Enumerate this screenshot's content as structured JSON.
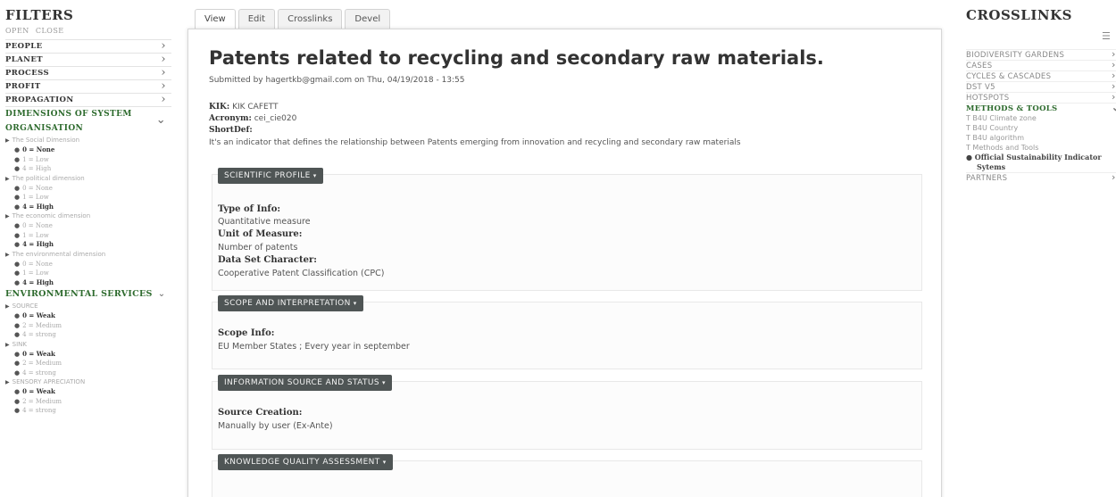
{
  "filters": {
    "title": "FILTERS",
    "open": "OPEN",
    "close": "CLOSE",
    "categories": [
      {
        "label": "PEOPLE"
      },
      {
        "label": "PLANET"
      },
      {
        "label": "PROCESS"
      },
      {
        "label": "PROFIT"
      },
      {
        "label": "PROPAGATION"
      }
    ],
    "dimensions_title_1": "DIMENSIONS OF SYSTEM",
    "dimensions_title_2": "ORGANISATION",
    "dimensions": [
      {
        "label": "The Social Dimension",
        "options": [
          {
            "text": "0 = None",
            "selected": true
          },
          {
            "text": "1 = Low",
            "selected": false
          },
          {
            "text": "4 = High",
            "selected": false
          }
        ]
      },
      {
        "label": "The political dimension",
        "options": [
          {
            "text": "0 = None",
            "selected": false
          },
          {
            "text": "1 = Low",
            "selected": false
          },
          {
            "text": "4 = High",
            "selected": true
          }
        ]
      },
      {
        "label": "The economic dimension",
        "options": [
          {
            "text": "0 = None",
            "selected": false
          },
          {
            "text": "1 = Low",
            "selected": false
          },
          {
            "text": "4 = High",
            "selected": true
          }
        ]
      },
      {
        "label": "The environmental dimension",
        "options": [
          {
            "text": "0 = None",
            "selected": false
          },
          {
            "text": "1 = Low",
            "selected": false
          },
          {
            "text": "4 = High",
            "selected": true
          }
        ]
      }
    ],
    "env_title": "ENVIRONMENTAL SERVICES",
    "env": [
      {
        "label": "SOURCE",
        "options": [
          {
            "text": "0 = Weak",
            "selected": true
          },
          {
            "text": "2 = Medium",
            "selected": false
          },
          {
            "text": "4 = strong",
            "selected": false
          }
        ]
      },
      {
        "label": "SINK",
        "options": [
          {
            "text": "0 = Weak",
            "selected": true
          },
          {
            "text": "2 = Medium",
            "selected": false
          },
          {
            "text": "4 = strong",
            "selected": false
          }
        ]
      },
      {
        "label": "SENSORY APRECIATION",
        "options": [
          {
            "text": "0 = Weak",
            "selected": true
          },
          {
            "text": "2 = Medium",
            "selected": false
          },
          {
            "text": "4 = strong",
            "selected": false
          }
        ]
      }
    ]
  },
  "tabs": [
    "View",
    "Edit",
    "Crosslinks",
    "Devel"
  ],
  "article": {
    "title": "Patents related to recycling and secondary raw materials.",
    "submitted": "Submitted by hagertkb@gmail.com on Thu, 04/19/2018 - 13:55",
    "kik_label": "KIK:",
    "kik_value": "KIK CAFETT",
    "acronym_label": "Acronym:",
    "acronym_value": "cei_cie020",
    "shortdef_label": "ShortDef:",
    "shortdef_value": "It's an indicator that defines the relationship between Patents emerging from innovation and recycling and secondary raw materials",
    "sections": [
      {
        "button": "SCIENTIFIC PROFILE",
        "fields": [
          {
            "label": "Type of Info:",
            "value": "Quantitative measure"
          },
          {
            "label": "Unit of Measure:",
            "value": "Number of patents"
          },
          {
            "label": "Data Set Character:",
            "value": "Cooperative Patent Classification (CPC)"
          }
        ]
      },
      {
        "button": "SCOPE AND INTERPRETATION",
        "fields": [
          {
            "label": "Scope Info:",
            "value": "EU Member States ; Every year in september"
          }
        ]
      },
      {
        "button": "INFORMATION SOURCE AND STATUS",
        "fields": [
          {
            "label": "Source Creation:",
            "value": "Manually by user (Ex-Ante)"
          }
        ]
      },
      {
        "button": "KNOWLEDGE QUALITY ASSESSMENT",
        "fields": []
      }
    ]
  },
  "crosslinks": {
    "title": "CROSSLINKS",
    "items_top": [
      "BIODIVERSITY GARDENS",
      "CASES",
      "CYCLES & CASCADES",
      "DST V5",
      "HOTSPOTS"
    ],
    "methods_head": "METHODS & TOOLS",
    "methods": [
      "T  B4U Climate zone",
      "T  B4U Country",
      "T  B4U algorithm",
      "T  Methods and Tools"
    ],
    "methods_selected_1": "Official Sustainability Indicator",
    "methods_selected_2": "Sytems",
    "partners": "PARTNERS"
  }
}
